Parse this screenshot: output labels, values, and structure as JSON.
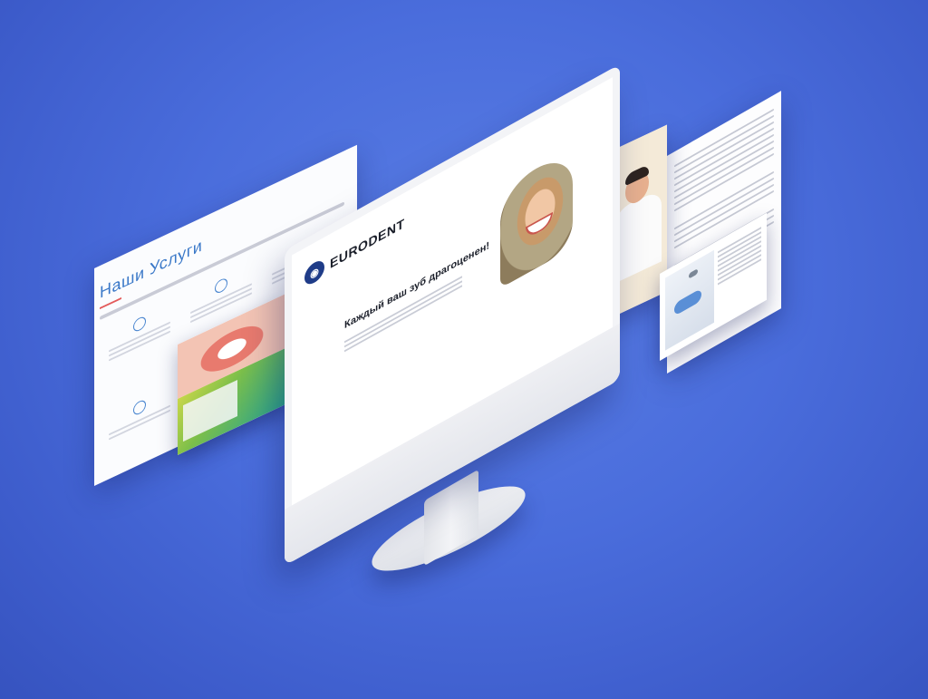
{
  "colors": {
    "background": "#4a6ddc",
    "brand_navy": "#1f3c88",
    "accent_red": "#e04a4a",
    "link_blue": "#3a78c8"
  },
  "services_page": {
    "title": "Наши Услуги",
    "items": [
      {
        "icon": "tooth-icon",
        "name": ""
      },
      {
        "icon": "tooth-icon",
        "name": ""
      },
      {
        "icon": "tooth-icon",
        "name": ""
      },
      {
        "icon": "tooth-icon",
        "name": ""
      }
    ]
  },
  "monitor_site": {
    "logo_icon": "tooth-icon",
    "brand": "EURODENT",
    "headline": "Каждый ваш зуб драгоценен!"
  },
  "equipment_card": {
    "heading": ""
  }
}
